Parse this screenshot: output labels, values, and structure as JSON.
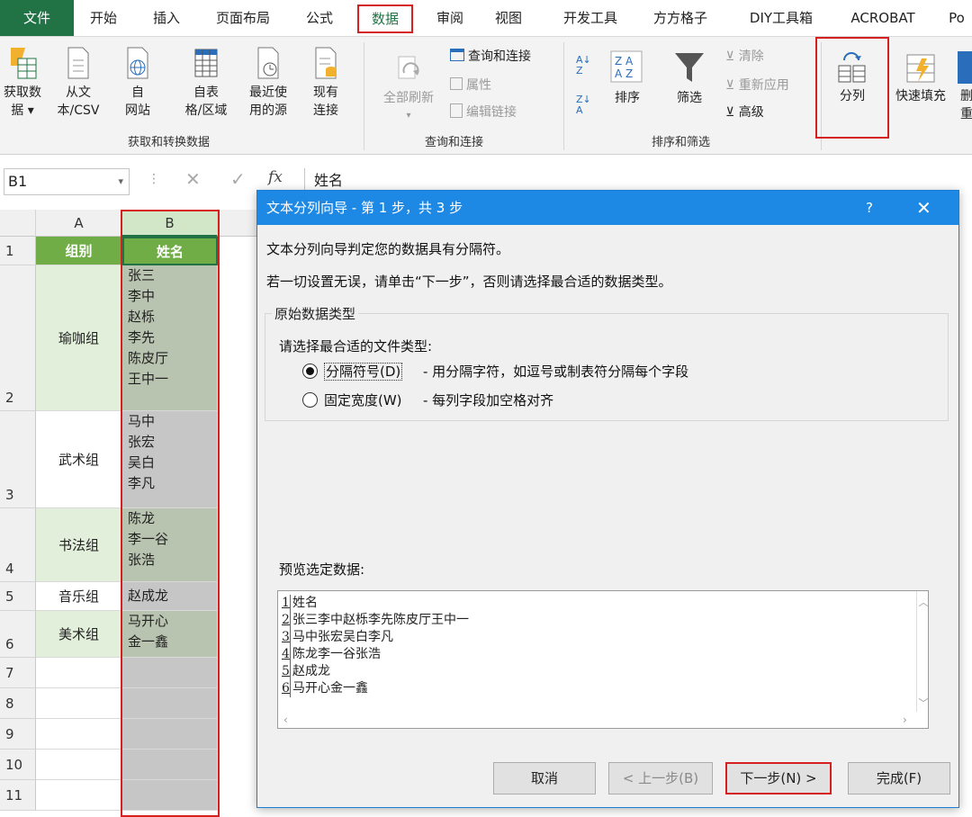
{
  "menu": {
    "tabs": [
      "文件",
      "开始",
      "插入",
      "页面布局",
      "公式",
      "数据",
      "审阅",
      "视图",
      "开发工具",
      "方方格子",
      "DIY工具箱",
      "ACROBAT",
      "Po"
    ]
  },
  "ribbon": {
    "get_data_label": "获取数",
    "get_data_label2": "据",
    "from_text_label": "从文",
    "from_text_label2": "本/CSV",
    "from_web_label": "自",
    "from_web_label2": "网站",
    "from_table_label": "自表",
    "from_table_label2": "格/区域",
    "recent_label": "最近使",
    "recent_label2": "用的源",
    "existing_label": "现有",
    "existing_label2": "连接",
    "group1": "获取和转换数据",
    "refresh_all_label": "全部刷新",
    "queries_label": "查询和连接",
    "properties_label": "属性",
    "edit_links_label": "编辑链接",
    "group2": "查询和连接",
    "sort_label": "排序",
    "filter_label": "筛选",
    "clear_label": "清除",
    "reapply_label": "重新应用",
    "advanced_label": "高级",
    "group3": "排序和筛选",
    "split_label": "分列",
    "flash_fill_label": "快速填充",
    "remove_dup_label": "删",
    "remove_dup_label2": "重"
  },
  "formula_bar": {
    "name_box": "B1",
    "fx": "fx",
    "content": "姓名"
  },
  "sheet": {
    "col_a": "A",
    "col_b": "B",
    "header_a": "组别",
    "header_b": "姓名",
    "rows": [
      {
        "num": "1"
      },
      {
        "num": "2",
        "group": "瑜咖组",
        "names": [
          "张三",
          "李中",
          "赵栎",
          "李先",
          "陈皮厅",
          "王中一"
        ]
      },
      {
        "num": "3",
        "group": "武术组",
        "names": [
          "马中",
          "张宏",
          "吴白",
          "李凡"
        ]
      },
      {
        "num": "4",
        "group": "书法组",
        "names": [
          "陈龙",
          "李一谷",
          "张浩"
        ]
      },
      {
        "num": "5",
        "group": "音乐组",
        "names": [
          "赵成龙"
        ]
      },
      {
        "num": "6",
        "group": "美术组",
        "names": [
          "马开心",
          "金一鑫"
        ]
      },
      {
        "num": "7"
      },
      {
        "num": "8"
      },
      {
        "num": "9"
      },
      {
        "num": "10"
      },
      {
        "num": "11"
      }
    ]
  },
  "dialog": {
    "title": "文本分列向导 - 第 1 步，共 3 步",
    "help": "?",
    "close": "✕",
    "line1": "文本分列向导判定您的数据具有分隔符。",
    "line2": "若一切设置无误，请单击“下一步”，否则请选择最合适的数据类型。",
    "group_title": "原始数据类型",
    "choose_label": "请选择最合适的文件类型:",
    "opt1_label": "分隔符号(D)",
    "opt1_desc": "- 用分隔字符，如逗号或制表符分隔每个字段",
    "opt2_label": "固定宽度(W)",
    "opt2_desc": "- 每列字段加空格对齐",
    "preview_label": "预览选定数据:",
    "preview_rows": [
      {
        "n": "1",
        "text": "姓名"
      },
      {
        "n": "2",
        "text": "张三李中赵栎李先陈皮厅王中一"
      },
      {
        "n": "3",
        "text": "马中张宏吴白李凡"
      },
      {
        "n": "4",
        "text": "陈龙李一谷张浩"
      },
      {
        "n": "5",
        "text": "赵成龙"
      },
      {
        "n": "6",
        "text": "马开心金一鑫"
      }
    ],
    "btn_cancel": "取消",
    "btn_back": "< 上一步(B)",
    "btn_next": "下一步(N) >",
    "btn_finish": "完成(F)"
  }
}
